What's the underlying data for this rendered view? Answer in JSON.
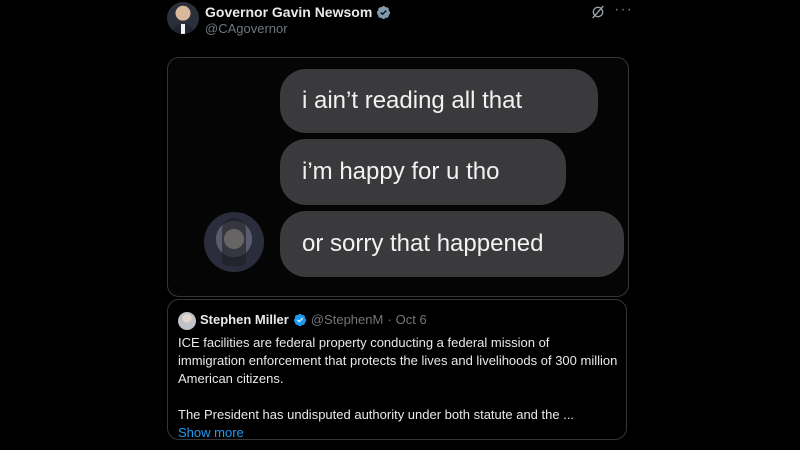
{
  "author": {
    "display_name": "Governor Gavin Newsom",
    "handle": "@CAgovernor",
    "verified_color": "#829aab"
  },
  "toolbar": {
    "grok_icon": "grok-icon",
    "more_icon": "more-icon",
    "more_glyph": "···"
  },
  "media": {
    "bubbles": [
      "i ain’t reading all that",
      "i’m happy for u tho",
      "or sorry that happened"
    ],
    "bubble_color": "#3a3a3c"
  },
  "quote": {
    "display_name": "Stephen Miller",
    "handle": "@StephenM",
    "separator": "·",
    "date": "Oct 6",
    "verified_color": "#1d9bf0",
    "text_1": "ICE facilities are federal property conducting a federal mission of immigration enforcement that protects the lives and livelihoods of 300 million American citizens.",
    "text_2": "The President has undisputed authority under both statute and the ...",
    "show_more": "Show more"
  },
  "colors": {
    "link": "#1d9bf0",
    "muted": "#71767b",
    "border": "#333639"
  }
}
